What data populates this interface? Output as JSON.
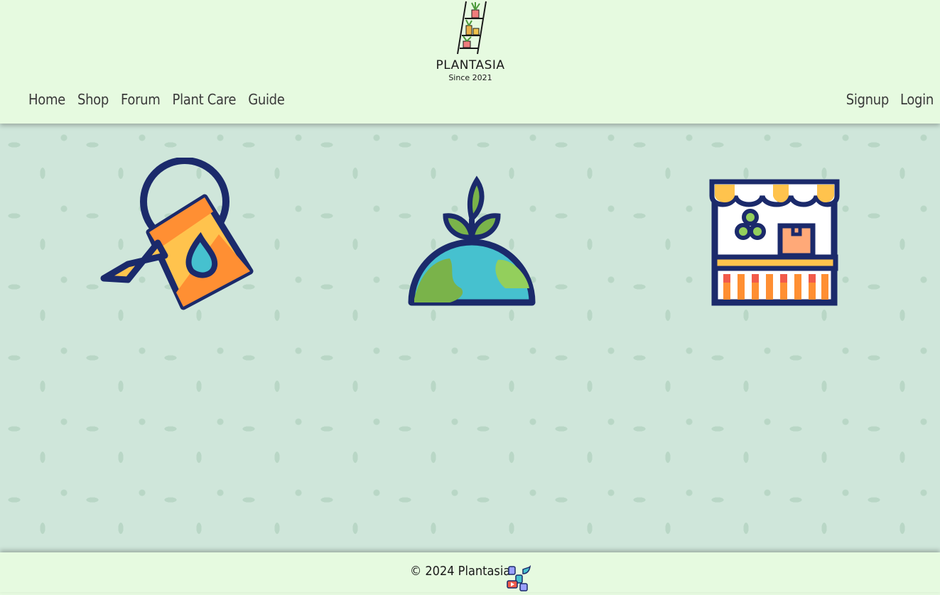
{
  "brand": {
    "name": "PLANTASIA",
    "tagline": "Since 2021"
  },
  "nav": {
    "left": [
      {
        "label": "Home"
      },
      {
        "label": "Shop"
      },
      {
        "label": "Forum"
      },
      {
        "label": "Plant Care"
      },
      {
        "label": "Guide"
      }
    ],
    "right": [
      {
        "label": "Signup"
      },
      {
        "label": "Login"
      }
    ]
  },
  "features": [
    {
      "icon": "watering-can-icon"
    },
    {
      "icon": "globe-sprout-icon"
    },
    {
      "icon": "market-stall-icon"
    }
  ],
  "footer": {
    "copyright": "© 2024 Plantasia",
    "icon": "social-media-icon"
  },
  "colors": {
    "header_bg": "#e6fae0",
    "main_bg": "#cfe6da",
    "outline": "#1b2a6b",
    "orange": "#ff8f33",
    "yellow": "#ffc34d",
    "blue": "#46c1cf",
    "green": "#7ab34a",
    "red": "#f25a4a"
  }
}
